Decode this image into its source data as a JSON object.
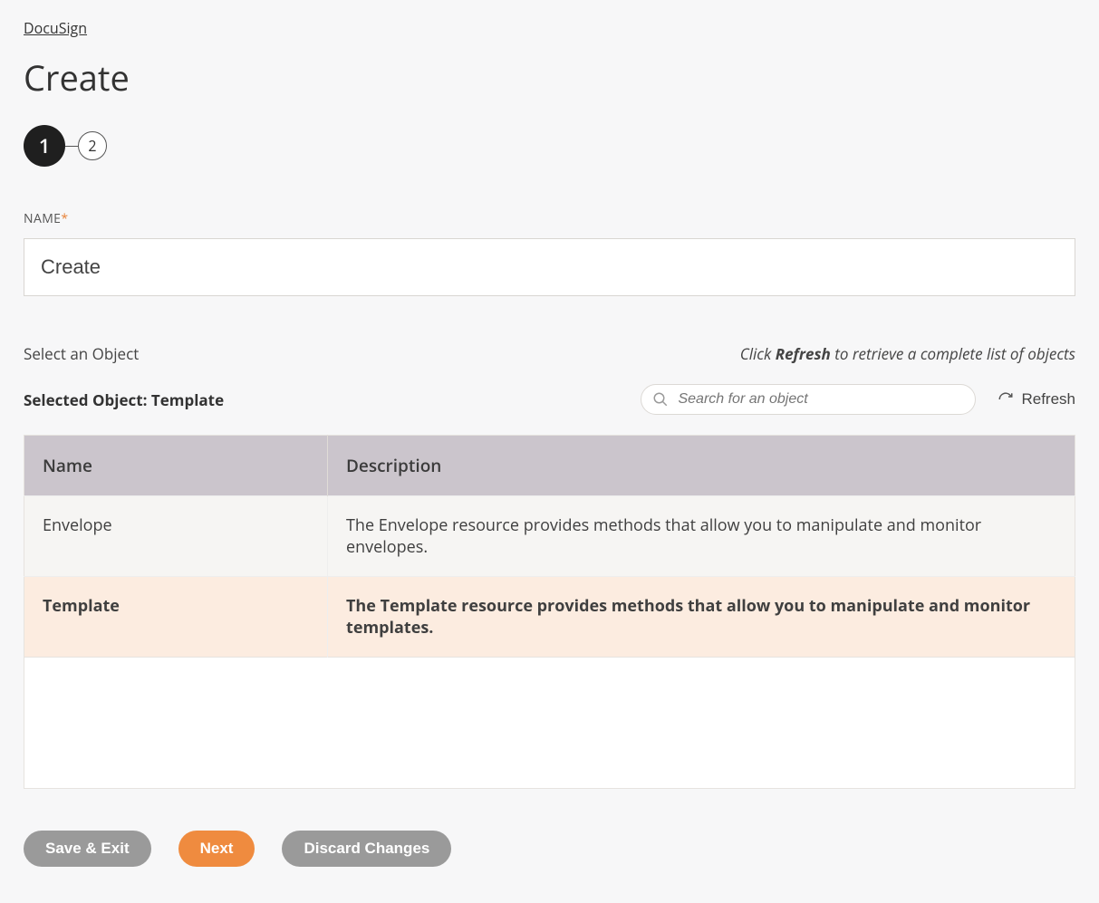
{
  "breadcrumb": "DocuSign",
  "page_title": "Create",
  "stepper": {
    "current": "1",
    "next": "2"
  },
  "name_field": {
    "label": "NAME",
    "required_marker": "*",
    "value": "Create"
  },
  "select_object": {
    "label": "Select an Object",
    "hint_prefix": "Click ",
    "hint_bold": "Refresh",
    "hint_suffix": " to retrieve a complete list of objects",
    "selected_prefix": "Selected Object: ",
    "selected_value": "Template",
    "search_placeholder": "Search for an object",
    "refresh_label": "Refresh"
  },
  "table": {
    "headers": {
      "name": "Name",
      "description": "Description"
    },
    "rows": [
      {
        "name": "Envelope",
        "description": "The Envelope resource provides methods that allow you to manipulate and monitor envelopes.",
        "selected": false
      },
      {
        "name": "Template",
        "description": "The Template resource provides methods that allow you to manipulate and monitor templates.",
        "selected": true
      }
    ]
  },
  "buttons": {
    "save_exit": "Save & Exit",
    "next": "Next",
    "discard": "Discard Changes"
  }
}
